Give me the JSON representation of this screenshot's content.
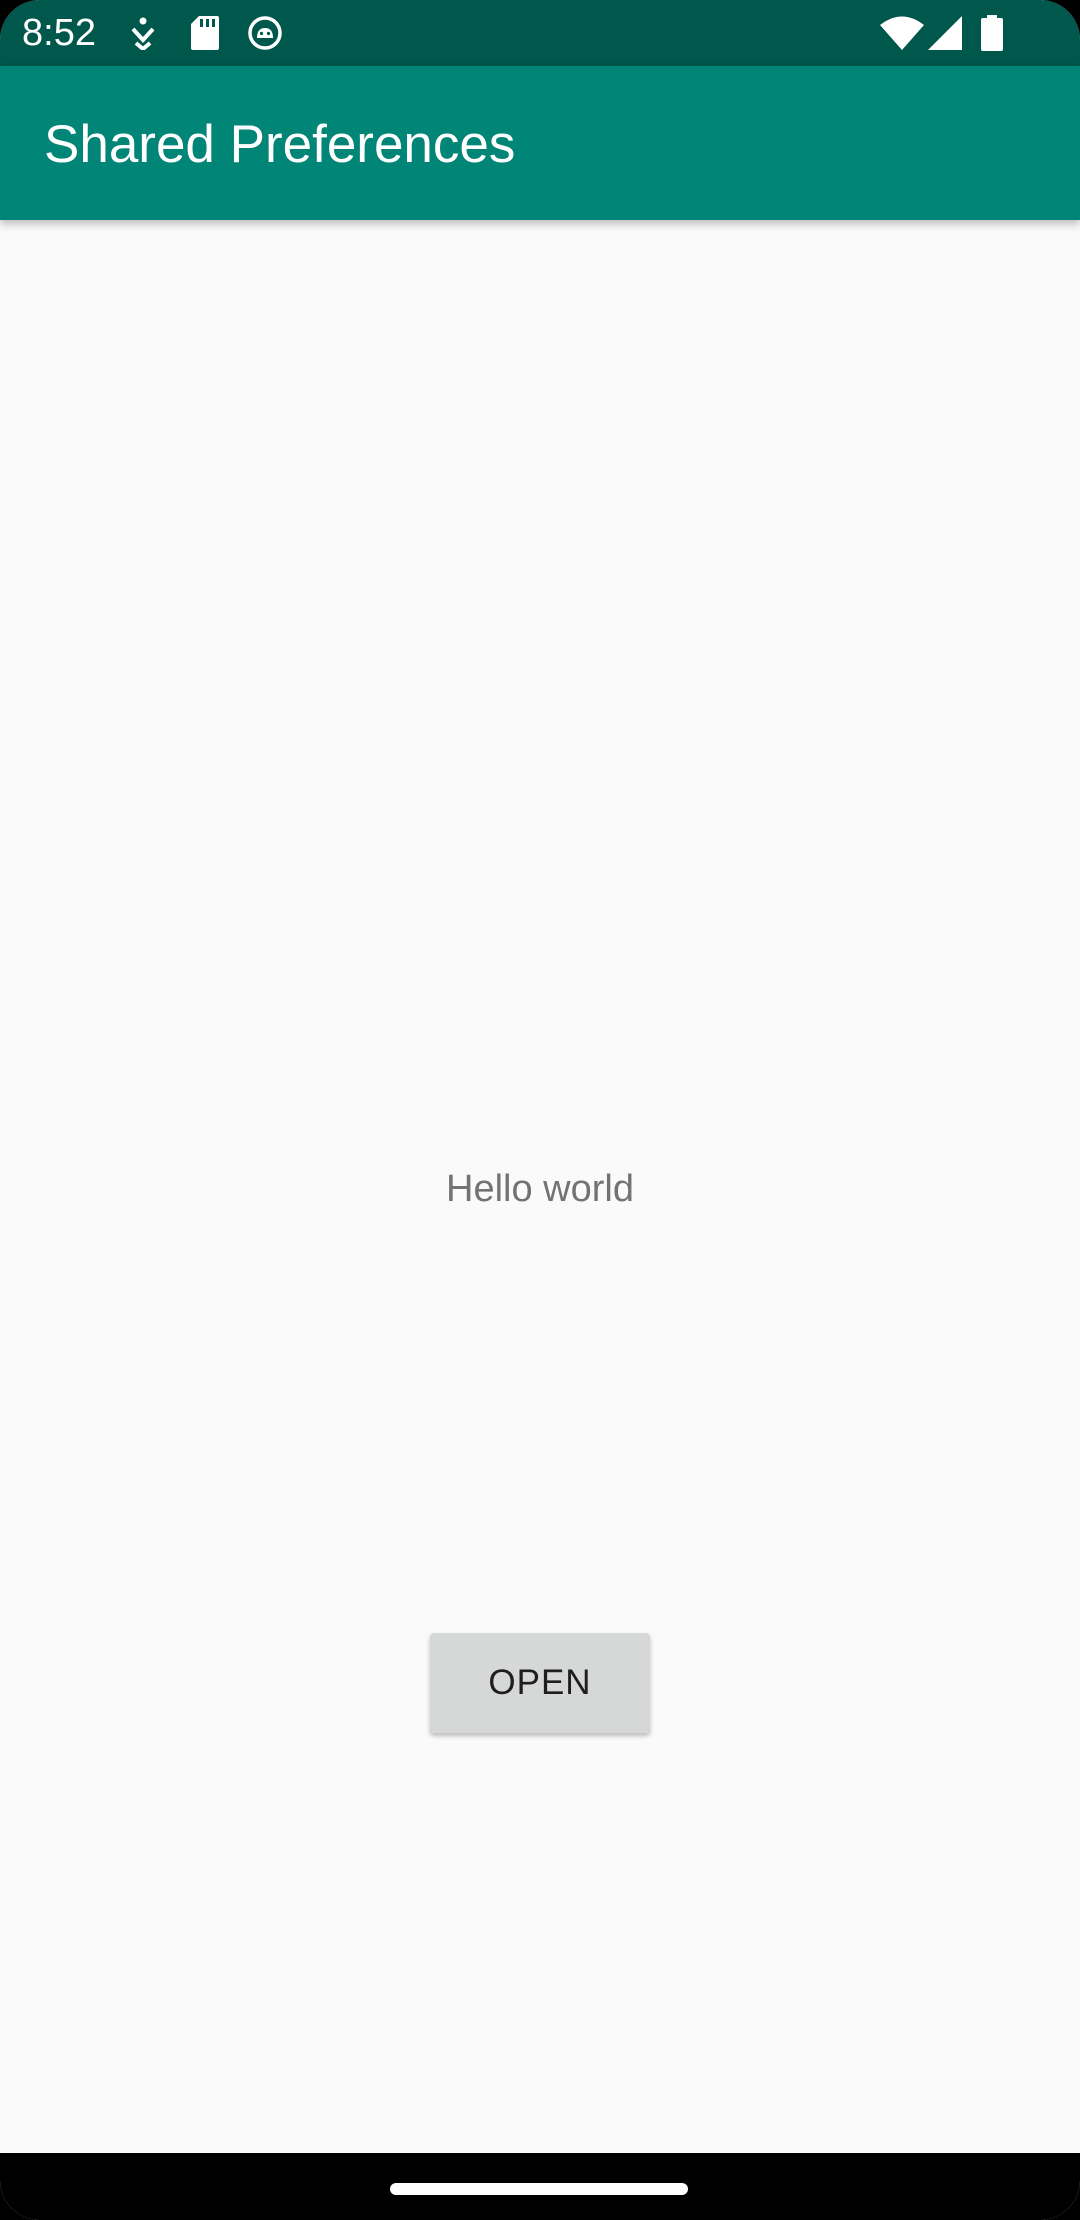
{
  "status_bar": {
    "time": "8:52",
    "icons_left": [
      "accessibility-icon",
      "sd-card-icon",
      "android-debug-icon"
    ],
    "icons_right": [
      "wifi-icon",
      "cell-signal-icon",
      "battery-icon"
    ]
  },
  "app_bar": {
    "title": "Shared Preferences"
  },
  "main": {
    "hello_text": "Hello world",
    "open_button_label": "OPEN"
  },
  "colors": {
    "status_bar": "#00574b",
    "app_bar": "#008577",
    "background": "#fafafa",
    "button": "#d6d7d7"
  }
}
